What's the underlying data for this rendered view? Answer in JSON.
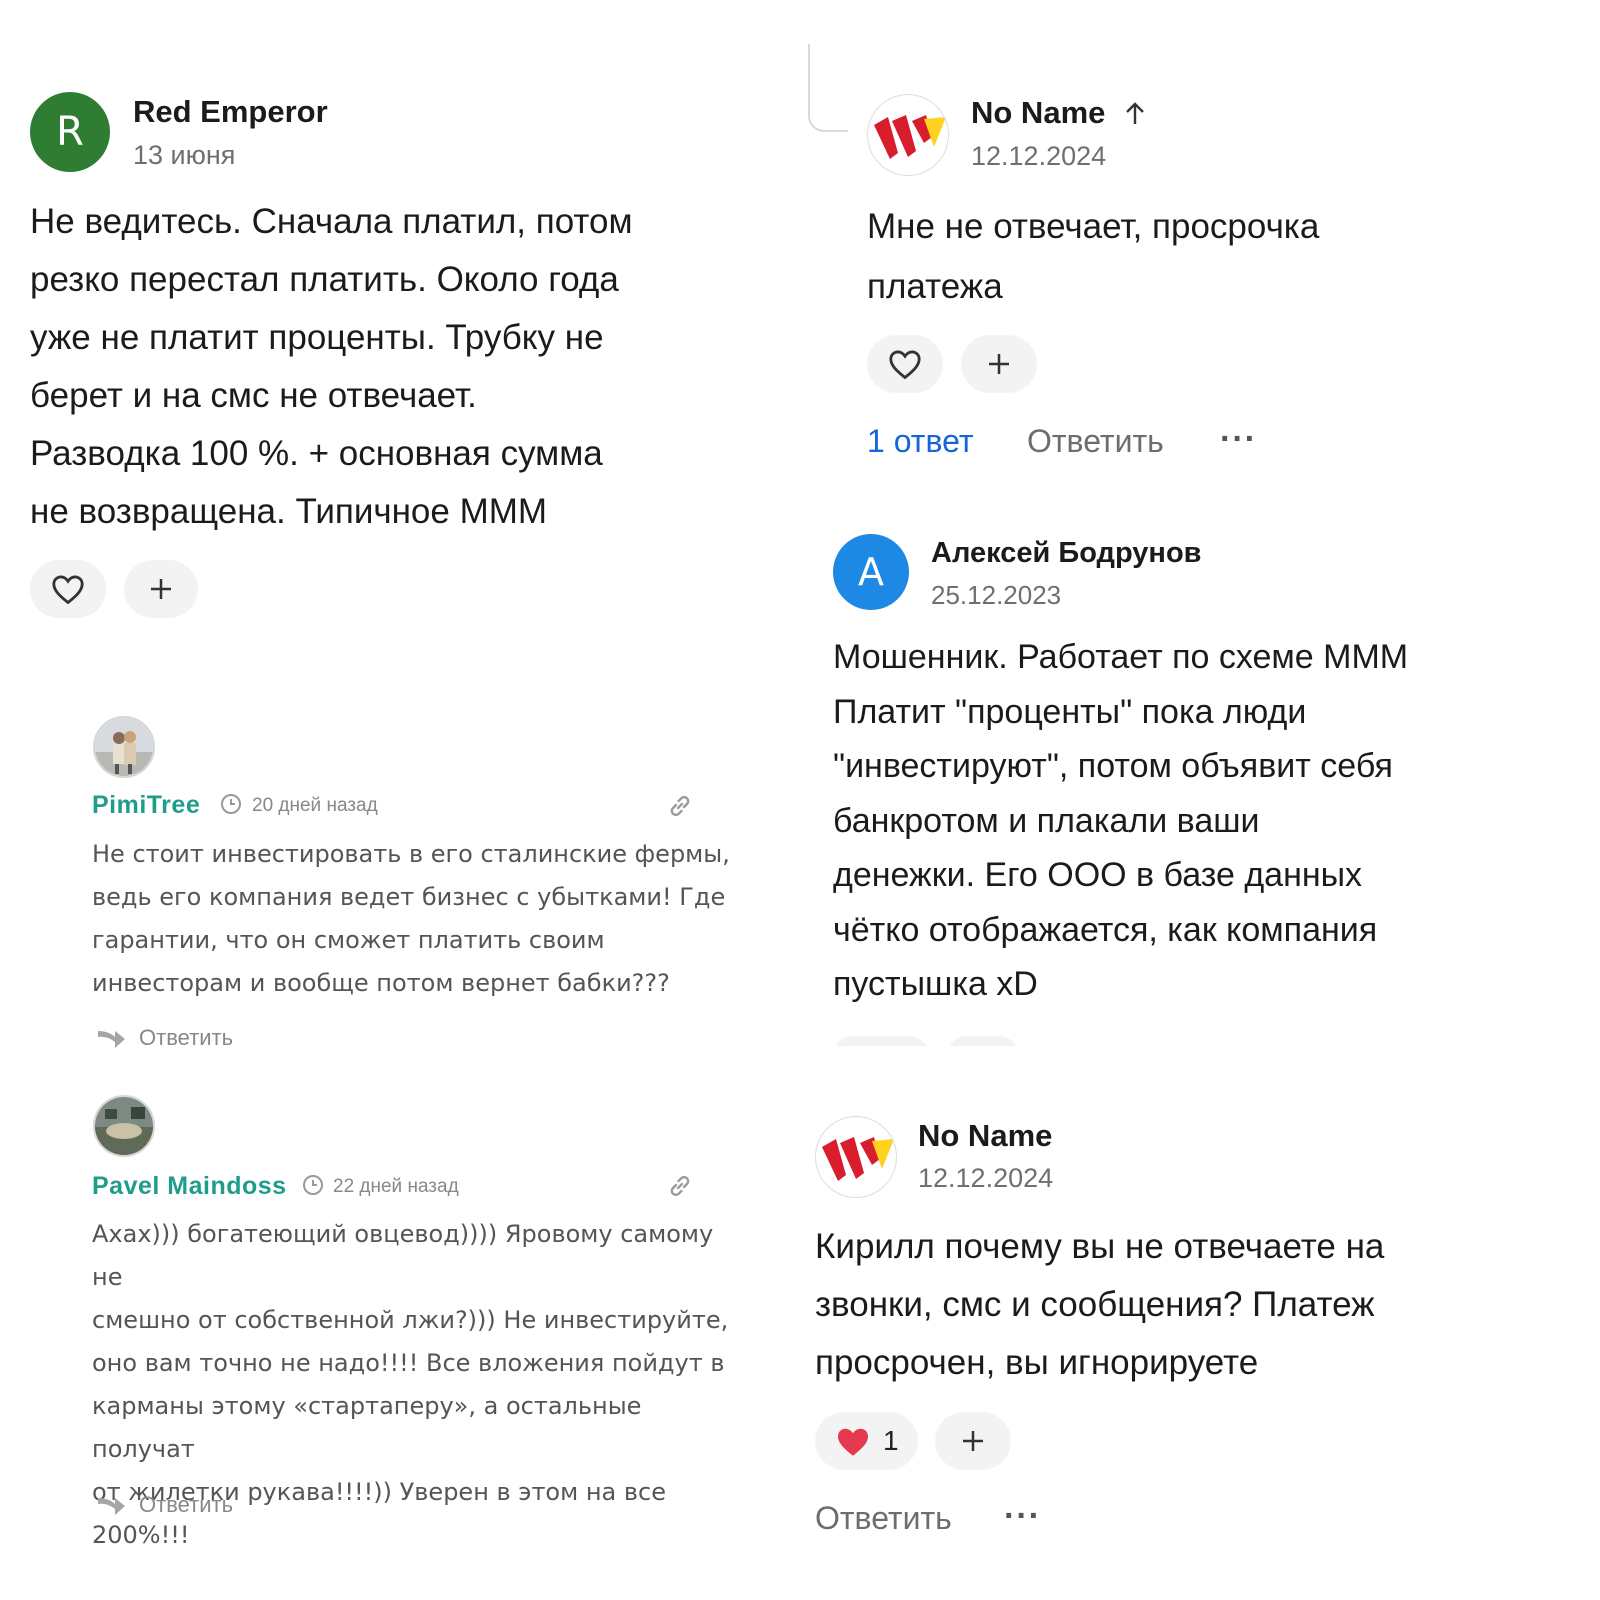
{
  "left": {
    "main_comment": {
      "avatar_letter": "R",
      "author": "Red Emperor",
      "date": "13 июня",
      "text": "Не ведитесь. Сначала платил, потом\nрезко перестал платить. Около года\nуже не платит проценты. Трубку не\nберет и на смс не отвечает.\nРазводка 100 %. + основная сумма\nне возвращена. Типичное МММ"
    },
    "vc_comments": [
      {
        "author": "PimiTree",
        "time": "20 дней назад",
        "text": "Не стоит инвестировать в его сталинские фермы,\nведь его компания ведет бизнес с убытками! Где\nгарантии, что он сможет платить своим\nинвесторам и вообще потом вернет бабки???",
        "reply_label": "Ответить"
      },
      {
        "author": "Pavel Maindoss",
        "time": "22 дней назад",
        "text": "Ахах))) богатеющий овцевод)))) Яровому самому не\nсмешно от собственной лжи?))) Не инвестируйте,\nоно вам точно не надо!!!! Все вложения пойдут в\nкарманы этому «стартаперу», а остальные получат\nот жилетки рукава!!!!)) Уверен в этом на все\n200%!!!",
        "reply_label": "Ответить"
      }
    ]
  },
  "right": {
    "comment1": {
      "author": "No Name",
      "date": "12.12.2024",
      "text": "Мне не отвечает, просрочка\nплатежа",
      "replies_label": "1 ответ",
      "reply_label": "Ответить",
      "more": "···"
    },
    "comment2": {
      "avatar_letter": "А",
      "author": "Алексей Бодрунов",
      "date": "25.12.2023",
      "text": "Мошенник. Работает по схеме МММ\nПлатит \"проценты\" пока люди\n\"инвестируют\", потом объявит себя\nбанкротом и плакали ваши\nденежки. Его ООО в базе данных\nчётко отображается, как компания\nпустышка xD"
    },
    "comment3": {
      "author": "No Name",
      "date": "12.12.2024",
      "text": "Кирилл почему вы не отвечаете на\nзвонки, смс и сообщения? Платеж\nпросрочен, вы игнорируете",
      "like_count": "1",
      "reply_label": "Ответить",
      "more": "···"
    }
  },
  "colors": {
    "avatar_green": "#2e7d32",
    "avatar_blue": "#1e88e5",
    "vc_name": "#1f9d8b",
    "replies_blue": "#1565d8",
    "heart_red": "#e53950"
  }
}
